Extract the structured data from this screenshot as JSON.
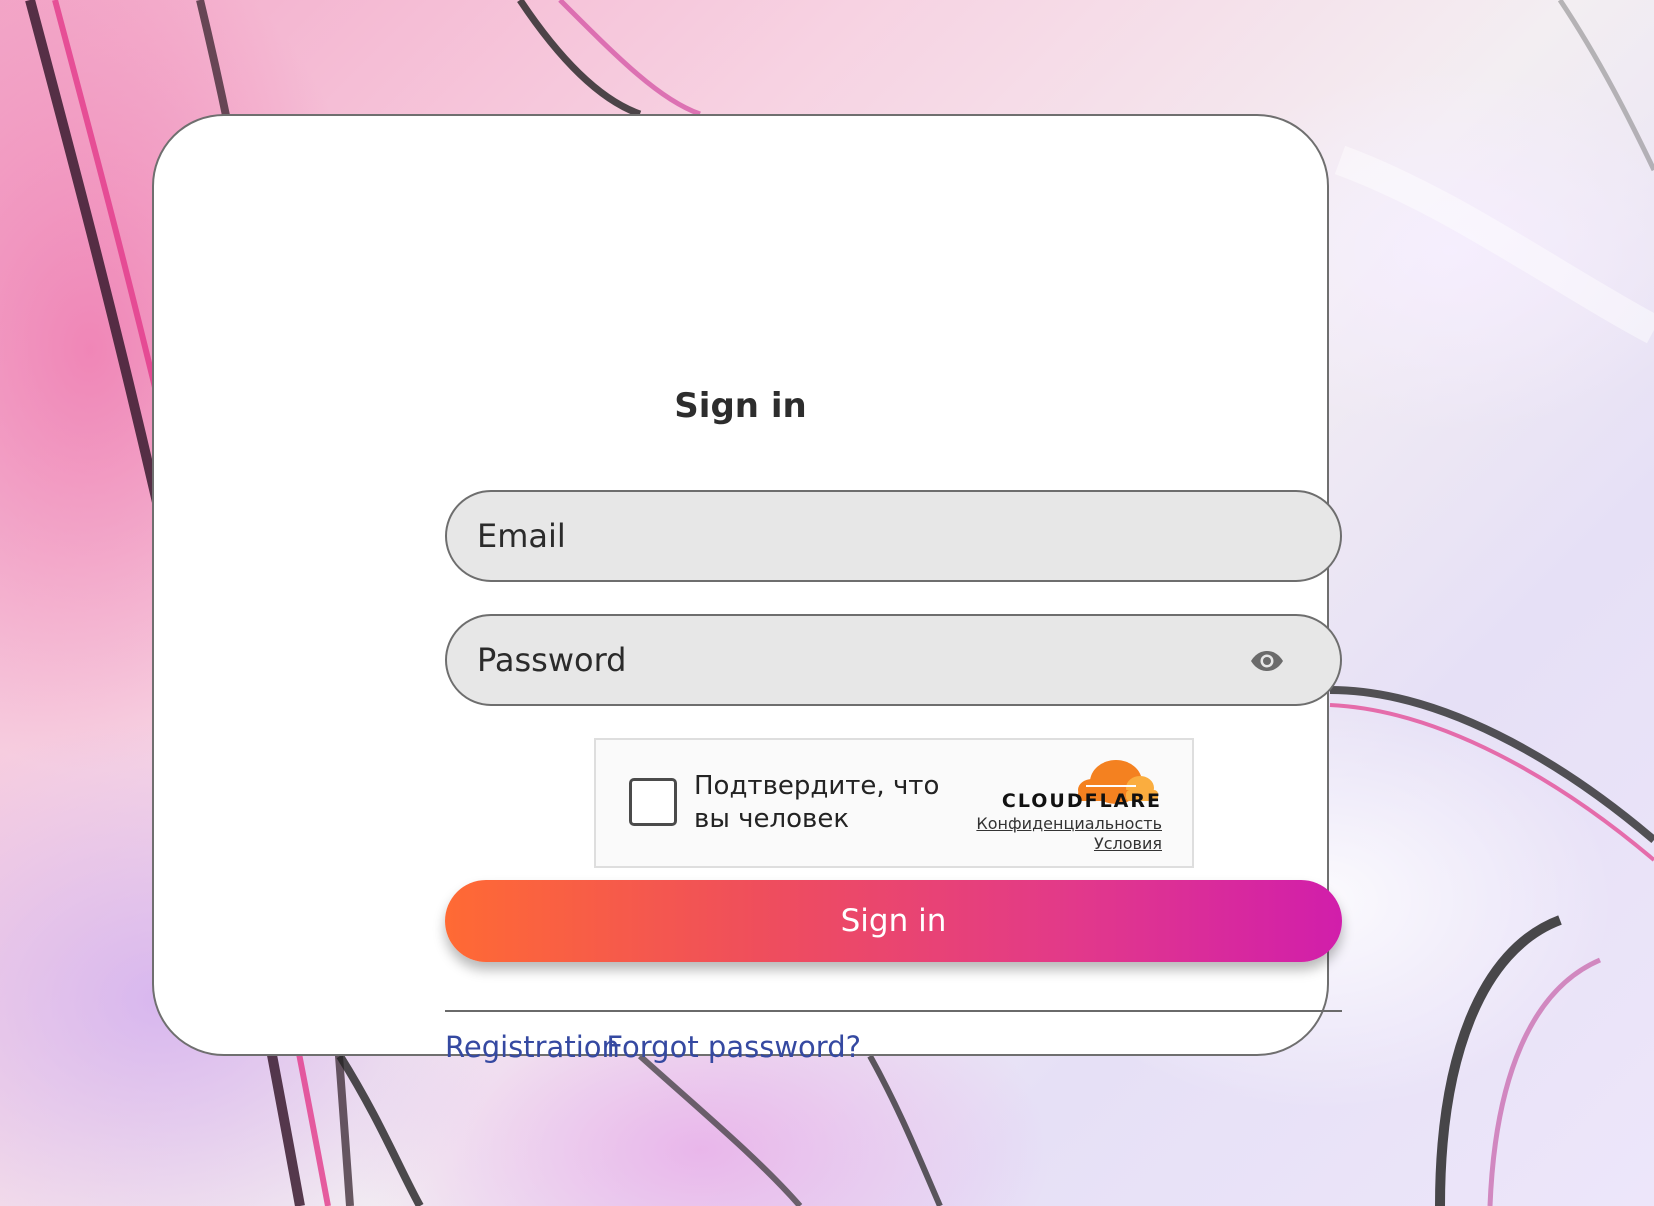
{
  "page": {
    "title": "Sign in",
    "email_placeholder": "Email",
    "password_placeholder": "Password",
    "submit_label": "Sign in",
    "registration_label": "Registration",
    "forgot_label": "Forgot password?"
  },
  "captcha": {
    "label": "Подтвердите, что вы человек",
    "brand": "CLOUDFLARE",
    "privacy_label": "Конфиденциальность",
    "terms_label": "Условия"
  },
  "icons": {
    "password_toggle": "eye-icon",
    "captcha_logo": "cloudflare-cloud-icon"
  },
  "colors": {
    "button_gradient_start": "#ff6a34",
    "button_gradient_end": "#d11eab",
    "link": "#3549a1",
    "field_bg": "#e7e7e7",
    "cloudflare_orange": "#f48120"
  }
}
